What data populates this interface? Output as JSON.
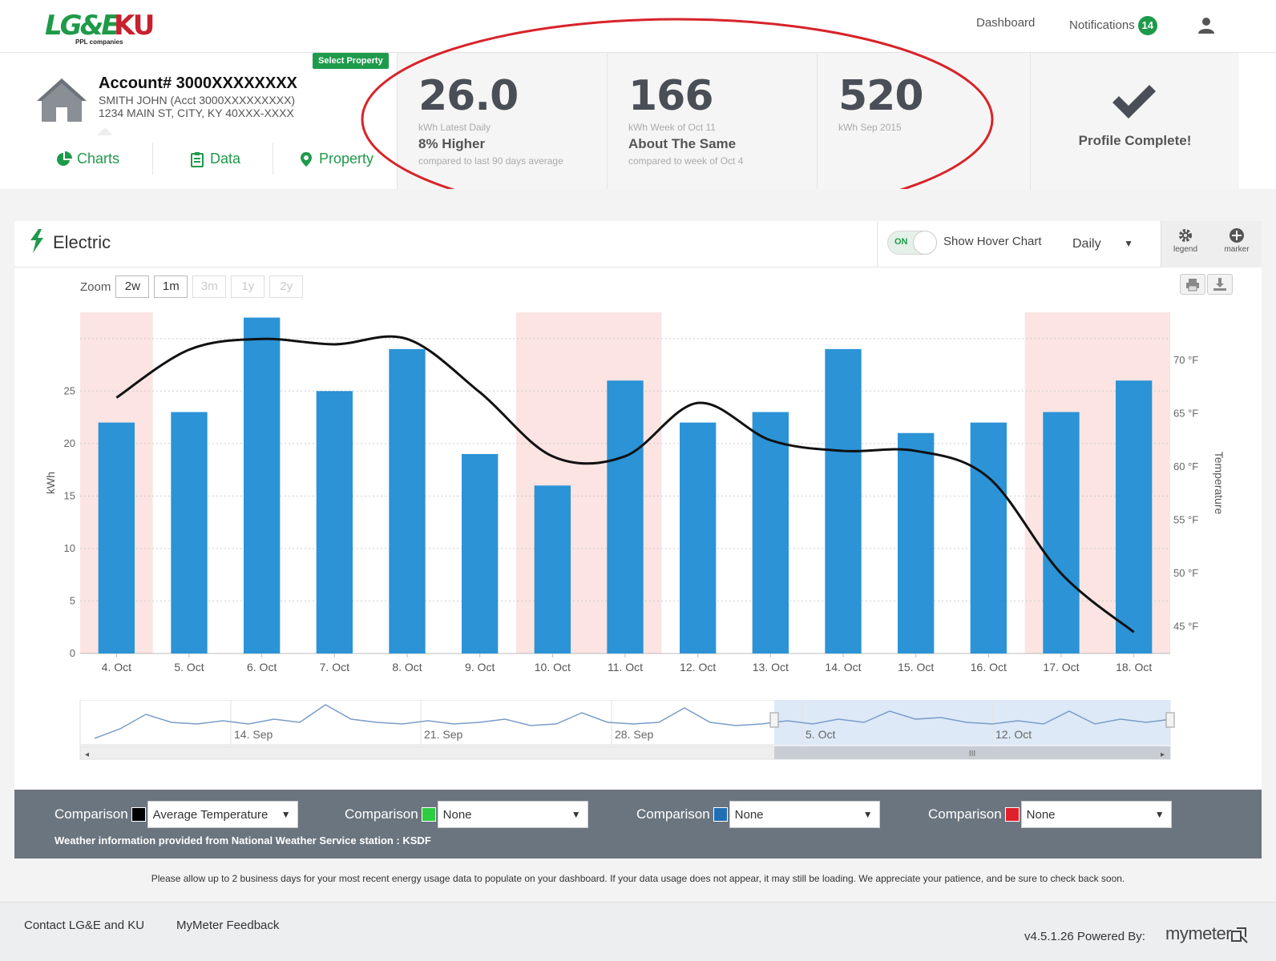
{
  "brand": {
    "lge": "LG&E",
    "ku": "KU",
    "tagline": "PPL companies"
  },
  "topnav": {
    "dashboard": "Dashboard",
    "notifications": "Notifications",
    "notification_count": "14"
  },
  "account": {
    "select_property": "Select Property",
    "title": "Account# 3000XXXXXXXX",
    "name_line": "SMITH JOHN  (Acct 3000XXXXXXXXX)",
    "address_line": "1234 MAIN ST, CITY, KY 40XXX-XXXX",
    "tabs": [
      {
        "label": "Charts",
        "icon": "pie-chart-icon"
      },
      {
        "label": "Data",
        "icon": "clipboard-icon"
      },
      {
        "label": "Property",
        "icon": "map-pin-icon"
      }
    ]
  },
  "stats": [
    {
      "value": "26.0",
      "unit": "kWh Latest Daily",
      "comparison": "8% Higher",
      "sub": "compared to last 90 days average"
    },
    {
      "value": "166",
      "unit": "kWh Week of Oct 11",
      "comparison": "About The Same",
      "sub": "compared to week of Oct 4"
    },
    {
      "value": "520",
      "unit": "kWh Sep 2015",
      "comparison": "",
      "sub": ""
    }
  ],
  "profile": {
    "text": "Profile Complete!"
  },
  "chart_panel": {
    "title": "Electric",
    "toggle_state": "ON",
    "hover_label": "Show Hover Chart",
    "period": "Daily",
    "tools": {
      "legend": "legend",
      "marker": "marker"
    },
    "zoom_label": "Zoom",
    "zoom_options": [
      "2w",
      "1m",
      "3m",
      "1y",
      "2y"
    ]
  },
  "colors": {
    "bar": "#2b93d6",
    "weekend": "#fbe4e2",
    "line": "#111111",
    "brand_green": "#1e9a4b",
    "brand_red": "#c8202e",
    "ellipse": "#d8232a"
  },
  "chart_data": {
    "type": "bar",
    "categories": [
      "4. Oct",
      "5. Oct",
      "6. Oct",
      "7. Oct",
      "8. Oct",
      "9. Oct",
      "10. Oct",
      "11. Oct",
      "12. Oct",
      "13. Oct",
      "14. Oct",
      "15. Oct",
      "16. Oct",
      "17. Oct",
      "18. Oct"
    ],
    "series": [
      {
        "type": "bar",
        "values": [
          22,
          23,
          32,
          25,
          29,
          19,
          16,
          26,
          22,
          23,
          29,
          21,
          22,
          23,
          26
        ],
        "axis": "left"
      },
      {
        "type": "line",
        "values": [
          66.5,
          71,
          72,
          71.5,
          72,
          67,
          61,
          61,
          66,
          62.5,
          61.5,
          61.5,
          59,
          50,
          44.5
        ],
        "axis": "right"
      }
    ],
    "ylabel": "kWh",
    "y2label": "Temperature",
    "yticks": [
      0,
      5,
      10,
      15,
      20,
      25
    ],
    "y2ticks": [
      "45 °F",
      "50 °F",
      "55 °F",
      "60 °F",
      "65 °F",
      "70 °F"
    ],
    "ylim": [
      0,
      32.5
    ],
    "y2lim": [
      42.5,
      74.5
    ],
    "weekend_bands": [
      [
        0,
        0
      ],
      [
        6,
        7
      ],
      [
        13,
        14
      ]
    ],
    "grid": true,
    "navigator": {
      "labels": [
        "14. Sep",
        "21. Sep",
        "28. Sep",
        "5. Oct",
        "12. Oct"
      ],
      "selected_range": [
        "4. Oct",
        "18. Oct"
      ],
      "scroll_label": "III"
    }
  },
  "comparisons": [
    {
      "label": "Comparison",
      "swatch": "#000000",
      "value": "Average Temperature"
    },
    {
      "label": "Comparison",
      "swatch": "#2ecc40",
      "value": "None"
    },
    {
      "label": "Comparison",
      "swatch": "#1f6fb5",
      "value": "None"
    },
    {
      "label": "Comparison",
      "swatch": "#e0202a",
      "value": "None"
    }
  ],
  "weather_note": "Weather information provided from National Weather Service station : KSDF",
  "notice": "Please allow up to 2 business days for your most recent energy usage data to populate on your dashboard. If your data usage does not appear, it may still be loading. We appreciate your patience, and be sure to check back soon.",
  "footer": {
    "contact": "Contact LG&E and KU",
    "feedback": "MyMeter Feedback",
    "version": "v4.5.1.26 Powered By:",
    "brand": "mymeter"
  }
}
